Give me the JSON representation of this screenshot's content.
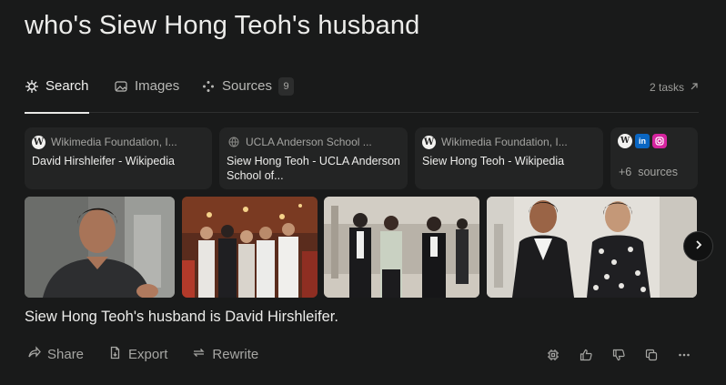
{
  "query": "who's Siew Hong Teoh's husband",
  "tabs": [
    {
      "label": "Search",
      "icon": "search-spark-icon",
      "active": true
    },
    {
      "label": "Images",
      "icon": "image-icon",
      "active": false
    },
    {
      "label": "Sources",
      "icon": "sources-icon",
      "active": false,
      "badge": "9"
    }
  ],
  "tasks_label": "2 tasks",
  "sources": [
    {
      "site": "Wikimedia Foundation, I...",
      "title": "David Hirshleifer - Wikipedia",
      "favicon": "W"
    },
    {
      "site": "UCLA Anderson School ...",
      "title": "Siew Hong Teoh - UCLA Anderson School of...",
      "favicon": "globe"
    },
    {
      "site": "Wikimedia Foundation, I...",
      "title": "Siew Hong Teoh - Wikipedia",
      "favicon": "W"
    }
  ],
  "more_sources": {
    "count_label": "+6",
    "suffix": "sources",
    "icons": [
      "wikipedia-icon",
      "linkedin-icon",
      "instagram-icon"
    ]
  },
  "images": [
    {
      "name": "woman-portrait-image"
    },
    {
      "name": "group-ceremony-image"
    },
    {
      "name": "lawyers-walking-image"
    },
    {
      "name": "two-women-image"
    }
  ],
  "answer": "Siew Hong Teoh's husband is David Hirshleifer.",
  "actions": {
    "share": "Share",
    "export": "Export",
    "rewrite": "Rewrite"
  },
  "colors": {
    "background": "#191a1a",
    "card": "#232424",
    "text": "#ececea",
    "muted": "#a6a6a3"
  }
}
